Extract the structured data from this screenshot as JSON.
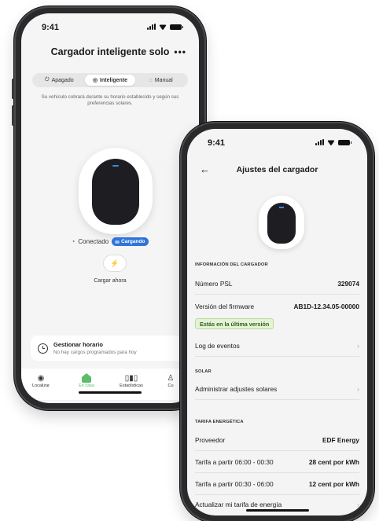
{
  "status_time": "9:41",
  "phone1": {
    "title": "Cargador inteligente solo",
    "more_label": "•••",
    "modes": [
      {
        "icon": "power-icon",
        "glyph": "⏻",
        "label": "Apagado"
      },
      {
        "icon": "smart-icon",
        "glyph": "◎",
        "label": "Inteligente"
      },
      {
        "icon": "manual-icon",
        "glyph": "◌",
        "label": "Manual"
      }
    ],
    "active_mode": "Inteligente",
    "mode_description": "Su vehículo cobrará durante su horario establecido y según sus preferencias solares.",
    "connection_status": "Conectado",
    "charging_badge": "Cargando",
    "charge_now_icon": "⚡",
    "charge_now_label": "Cargar ahora",
    "schedule": {
      "title": "Gestionar horario",
      "subtitle": "No hay cargos programados para hoy"
    },
    "tabs": [
      {
        "icon": "location-icon",
        "glyph": "◉",
        "label": "Localizar"
      },
      {
        "icon": "home-icon",
        "glyph": "",
        "label": "En casa"
      },
      {
        "icon": "stats-icon",
        "glyph": "▯▮▯",
        "label": "Estadísticas"
      },
      {
        "icon": "user-icon",
        "glyph": "♙",
        "label": "Cu"
      }
    ],
    "active_tab": "En casa"
  },
  "phone2": {
    "back_icon": "←",
    "title": "Ajustes del cargador",
    "charger_info_header": "INFORMACIÓN DEL CARGADOR",
    "psl_label": "Número PSL",
    "psl_value": "329074",
    "firmware_label": "Versión del firmware",
    "firmware_value": "AB1D-12.34.05-00000",
    "latest_version_badge": "Estás en la última versión",
    "event_log_label": "Log de eventos",
    "solar_header": "SOLAR",
    "solar_settings_label": "Administrar adjustes solares",
    "tariff_header": "TARIFA ENERGÉTICA",
    "provider_label": "Proveedor",
    "provider_value": "EDF Energy",
    "tariff1_label": "Tarifa a partir 06:00 - 00:30",
    "tariff1_value": "28 cent por kWh",
    "tariff2_label": "Tarifa a partir 00:30 - 06:00",
    "tariff2_value": "12 cent por kWh",
    "update_tariff_label": "Actualizar mi tarifa de energía",
    "chevron": "›"
  }
}
